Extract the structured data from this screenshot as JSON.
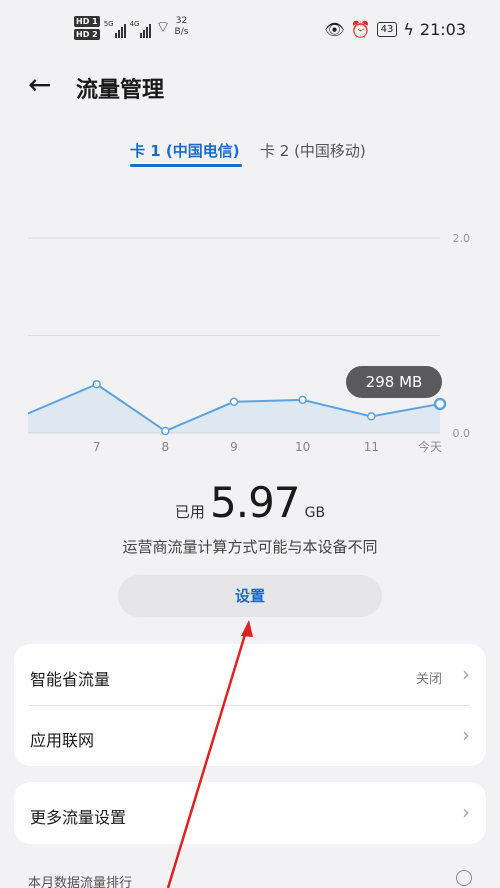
{
  "status_bar": {
    "hd1": "HD 1",
    "hd2": "HD 2",
    "net1": "5G",
    "net2": "4G",
    "speed_value": "32",
    "speed_unit": "B/s",
    "battery": "43",
    "time": "21:03"
  },
  "header": {
    "back_icon": "arrow-left-icon",
    "title": "流量管理"
  },
  "tabs": [
    {
      "label": "卡 1 (中国电信)",
      "active": true
    },
    {
      "label": "卡 2 (中国移动)",
      "active": false
    }
  ],
  "chart_data": {
    "type": "area",
    "x_labels": [
      "7",
      "8",
      "9",
      "10",
      "11",
      "今天"
    ],
    "y_ticks": [
      "2.0",
      "0.0"
    ],
    "ylim": [
      0,
      2.0
    ],
    "points": [
      0.2,
      0.5,
      0.02,
      0.32,
      0.34,
      0.17,
      0.298
    ],
    "tooltip": "298 MB",
    "color": "#5aa3e0"
  },
  "usage": {
    "prefix": "已用",
    "value": "5.97",
    "unit": "GB"
  },
  "note": "运营商流量计算方式可能与本设备不同",
  "settings_button": "设置",
  "list_card_1": [
    {
      "label": "智能省流量",
      "value": "关闭"
    },
    {
      "label": "应用联网",
      "value": ""
    }
  ],
  "list_card_2": [
    {
      "label": "更多流量设置",
      "value": ""
    }
  ],
  "ranking_label": "本月数据流量排行"
}
